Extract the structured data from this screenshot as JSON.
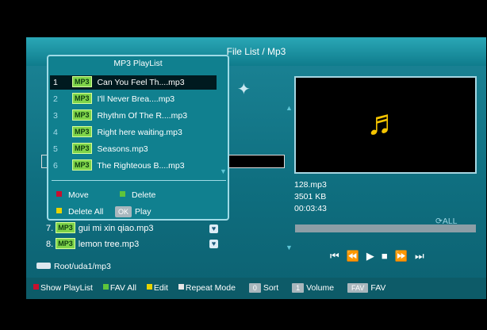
{
  "header": {
    "title": "File List / Mp3"
  },
  "playlist": {
    "title": "MP3 PlayList",
    "items": [
      {
        "num": "1",
        "name": "Can You Feel Th....mp3"
      },
      {
        "num": "2",
        "name": "I'll Never Brea....mp3"
      },
      {
        "num": "3",
        "name": "Rhythm Of The R....mp3"
      },
      {
        "num": "4",
        "name": "Right here waiting.mp3"
      },
      {
        "num": "5",
        "name": "Seasons.mp3"
      },
      {
        "num": "6",
        "name": "The Righteous B....mp3"
      }
    ],
    "legend": {
      "move": "Move",
      "delete": "Delete",
      "delete_all": "Delete All",
      "ok": "OK",
      "play": "Play"
    }
  },
  "file_list": {
    "items": [
      {
        "num": "7.",
        "name": "gui mi xin qiao.mp3"
      },
      {
        "num": "8.",
        "name": "lemon tree.mp3"
      }
    ]
  },
  "tag": "MP3",
  "info": {
    "file": "128.mp3",
    "size": "3501 KB",
    "duration": "00:03:43",
    "repeat": "ALL"
  },
  "path": "Root/uda1/mp3",
  "bottom": {
    "show_playlist": "Show PlayList",
    "fav_all": "FAV All",
    "edit": "Edit",
    "repeat_mode": "Repeat Mode",
    "sort_key": "0",
    "sort": "Sort",
    "volume_key": "1",
    "volume": "Volume",
    "fav_key": "FAV",
    "fav": "FAV"
  },
  "colors": {
    "red": "#c8102e",
    "green": "#5fc43b",
    "yellow": "#e7d300",
    "white": "#e6e6e6",
    "note": "#f5c400"
  },
  "icons": [
    "music-note-icon",
    "usb-icon",
    "skip-prev-icon",
    "rewind-icon",
    "play-icon",
    "stop-icon",
    "fast-forward-icon",
    "skip-next-icon",
    "repeat-icon"
  ]
}
